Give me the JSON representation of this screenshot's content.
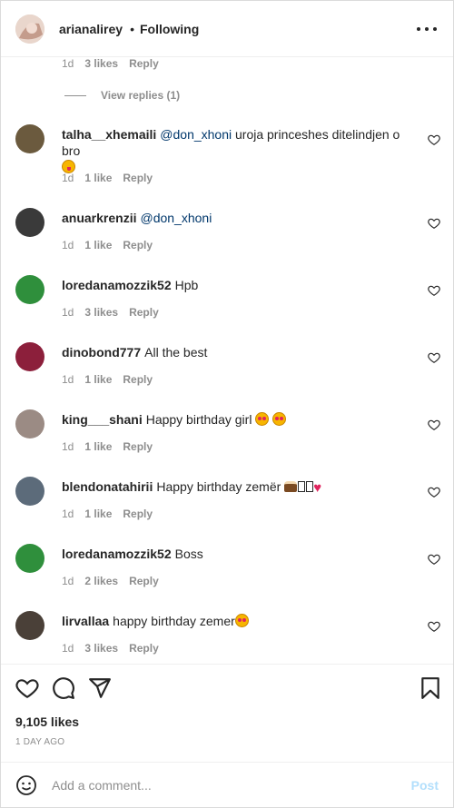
{
  "header": {
    "username": "arianalirey",
    "separator": "•",
    "follow_status": "Following",
    "avatar_color": "#d9c3b8",
    "more_icon": "more-horizontal-icon"
  },
  "previous_comment": {
    "time": "1d",
    "likes": "3 likes",
    "reply": "Reply",
    "view_replies": "View replies (1)"
  },
  "comments": [
    {
      "username": "talha__xhemaili",
      "mention": "@don_xhoni",
      "text": " uroja princeshes ditelindjen o bro",
      "emoji": "tongue",
      "time": "1d",
      "likes": "1 like",
      "reply": "Reply",
      "avatar_color": "#6b5a3e"
    },
    {
      "username": "anuarkrenzii",
      "mention": "@don_xhoni",
      "text": "",
      "time": "1d",
      "likes": "1 like",
      "reply": "Reply",
      "avatar_color": "#3a3a3a"
    },
    {
      "username": "loredanamozzik52",
      "mention": "",
      "text": "Hpb",
      "time": "1d",
      "likes": "3 likes",
      "reply": "Reply",
      "avatar_color": "#2f8f3c"
    },
    {
      "username": "dinobond777",
      "mention": "",
      "text": "All the best",
      "time": "1d",
      "likes": "1 like",
      "reply": "Reply",
      "avatar_color": "#8c1f3b"
    },
    {
      "username": "king___shani",
      "mention": "",
      "text": "Happy birthday girl",
      "emoji": "hearteyes2",
      "time": "1d",
      "likes": "1 like",
      "reply": "Reply",
      "avatar_color": "#9b8b84"
    },
    {
      "username": "blendonatahirii",
      "mention": "",
      "text": "Happy birthday zemër",
      "emoji": "cake-heart",
      "time": "1d",
      "likes": "1 like",
      "reply": "Reply",
      "avatar_color": "#5c6b7a"
    },
    {
      "username": "loredanamozzik52",
      "mention": "",
      "text": "Boss",
      "time": "1d",
      "likes": "2 likes",
      "reply": "Reply",
      "avatar_color": "#2f8f3c"
    },
    {
      "username": "lirvallaa",
      "mention": "",
      "text": "happy birthday zemer",
      "emoji": "hearteyes1",
      "time": "1d",
      "likes": "3 likes",
      "reply": "Reply",
      "avatar_color": "#4a4038"
    }
  ],
  "actions": {
    "like_icon": "heart-icon",
    "comment_icon": "comment-icon",
    "share_icon": "paper-plane-icon",
    "save_icon": "bookmark-icon",
    "likes_total": "9,105 likes",
    "timestamp": "1 DAY AGO"
  },
  "add_comment": {
    "emoji_icon": "smiley-icon",
    "placeholder": "Add a comment...",
    "post_label": "Post",
    "post_color": "#b2dffc"
  }
}
